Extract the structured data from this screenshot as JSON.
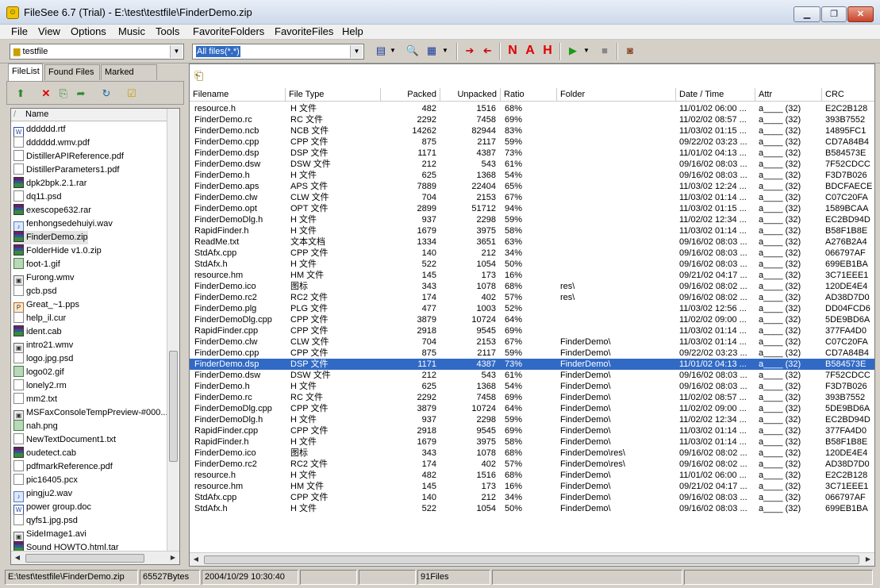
{
  "window": {
    "title": "FileSee 6.7 (Trial) - E:\\test\\testfile\\FinderDemo.zip",
    "min": "▁",
    "max": "❐",
    "close": "✕"
  },
  "menu": [
    "File",
    "View",
    "Options",
    "Music",
    "Tools",
    "FavoriteFolders",
    "FavoriteFiles",
    "Help"
  ],
  "toolbar": {
    "folder_combo": "testfile",
    "filter_combo": "All files(*.*)",
    "letters": [
      "N",
      "A",
      "H"
    ]
  },
  "left": {
    "tabs": [
      "FileList",
      "Found Files",
      "Marked Files"
    ],
    "column_header": "Name",
    "items": [
      {
        "name": "dddddd.rtf",
        "icon": "doc"
      },
      {
        "name": "dddddd.wmv.pdf",
        "icon": "file"
      },
      {
        "name": "DistillerAPIReference.pdf",
        "icon": "file"
      },
      {
        "name": "DistillerParameters1.pdf",
        "icon": "file"
      },
      {
        "name": "dpk2bpk.2.1.rar",
        "icon": "rar"
      },
      {
        "name": "dq11.psd",
        "icon": "file"
      },
      {
        "name": "exescope632.rar",
        "icon": "rar"
      },
      {
        "name": "fenhongsedehuiyi.wav",
        "icon": "aud"
      },
      {
        "name": "FinderDemo.zip",
        "icon": "rar"
      },
      {
        "name": "FolderHide v1.0.zip",
        "icon": "rar"
      },
      {
        "name": "foot-1.gif",
        "icon": "img"
      },
      {
        "name": "Furong.wmv",
        "icon": "vid"
      },
      {
        "name": "gcb.psd",
        "icon": "file"
      },
      {
        "name": "Great_~1.pps",
        "icon": "pps"
      },
      {
        "name": "help_il.cur",
        "icon": "file"
      },
      {
        "name": "ident.cab",
        "icon": "rar"
      },
      {
        "name": "intro21.wmv",
        "icon": "vid"
      },
      {
        "name": "logo.jpg.psd",
        "icon": "file"
      },
      {
        "name": "logo02.gif",
        "icon": "img"
      },
      {
        "name": "lonely2.rm",
        "icon": "file"
      },
      {
        "name": "mm2.txt",
        "icon": "file"
      },
      {
        "name": "MSFaxConsoleTempPreview-#000...",
        "icon": "vid"
      },
      {
        "name": "nah.png",
        "icon": "img"
      },
      {
        "name": "NewTextDocument1.txt",
        "icon": "file"
      },
      {
        "name": "oudetect.cab",
        "icon": "rar"
      },
      {
        "name": "pdfmarkReference.pdf",
        "icon": "file"
      },
      {
        "name": "pic16405.pcx",
        "icon": "file"
      },
      {
        "name": "pingju2.wav",
        "icon": "aud"
      },
      {
        "name": "power group.doc",
        "icon": "doc"
      },
      {
        "name": "qyfs1.jpg.psd",
        "icon": "file"
      },
      {
        "name": "SideImage1.avi",
        "icon": "vid"
      },
      {
        "name": "Sound HOWTO.html.tar",
        "icon": "rar"
      }
    ]
  },
  "list": {
    "columns": [
      "Filename",
      "File Type",
      "Packed",
      "Unpacked",
      "Ratio",
      "Folder",
      "Date / Time",
      "Attr",
      "CRC"
    ],
    "rows": [
      [
        "resource.h",
        "H 文件",
        "482",
        "1516",
        "68%",
        "",
        "11/01/02 06:00 ...",
        "a____ (32)",
        "E2C2B128"
      ],
      [
        "FinderDemo.rc",
        "RC 文件",
        "2292",
        "7458",
        "69%",
        "",
        "11/02/02 08:57 ...",
        "a____ (32)",
        "393B7552"
      ],
      [
        "FinderDemo.ncb",
        "NCB 文件",
        "14262",
        "82944",
        "83%",
        "",
        "11/03/02 01:15 ...",
        "a____ (32)",
        "14895FC1"
      ],
      [
        "FinderDemo.cpp",
        "CPP 文件",
        "875",
        "2117",
        "59%",
        "",
        "09/22/02 03:23 ...",
        "a____ (32)",
        "CD7A84B4"
      ],
      [
        "FinderDemo.dsp",
        "DSP 文件",
        "1171",
        "4387",
        "73%",
        "",
        "11/01/02 04:13 ...",
        "a____ (32)",
        "B584573E"
      ],
      [
        "FinderDemo.dsw",
        "DSW 文件",
        "212",
        "543",
        "61%",
        "",
        "09/16/02 08:03 ...",
        "a____ (32)",
        "7F52CDCC"
      ],
      [
        "FinderDemo.h",
        "H 文件",
        "625",
        "1368",
        "54%",
        "",
        "09/16/02 08:03 ...",
        "a____ (32)",
        "F3D7B026"
      ],
      [
        "FinderDemo.aps",
        "APS 文件",
        "7889",
        "22404",
        "65%",
        "",
        "11/03/02 12:24 ...",
        "a____ (32)",
        "BDCFAECE"
      ],
      [
        "FinderDemo.clw",
        "CLW 文件",
        "704",
        "2153",
        "67%",
        "",
        "11/03/02 01:14 ...",
        "a____ (32)",
        "C07C20FA"
      ],
      [
        "FinderDemo.opt",
        "OPT 文件",
        "2899",
        "51712",
        "94%",
        "",
        "11/03/02 01:15 ...",
        "a____ (32)",
        "1589BCAA"
      ],
      [
        "FinderDemoDlg.h",
        "H 文件",
        "937",
        "2298",
        "59%",
        "",
        "11/02/02 12:34 ...",
        "a____ (32)",
        "EC2BD94D"
      ],
      [
        "RapidFinder.h",
        "H 文件",
        "1679",
        "3975",
        "58%",
        "",
        "11/03/02 01:14 ...",
        "a____ (32)",
        "B58F1B8E"
      ],
      [
        "ReadMe.txt",
        "文本文档",
        "1334",
        "3651",
        "63%",
        "",
        "09/16/02 08:03 ...",
        "a____ (32)",
        "A276B2A4"
      ],
      [
        "StdAfx.cpp",
        "CPP 文件",
        "140",
        "212",
        "34%",
        "",
        "09/16/02 08:03 ...",
        "a____ (32)",
        "066797AF"
      ],
      [
        "StdAfx.h",
        "H 文件",
        "522",
        "1054",
        "50%",
        "",
        "09/16/02 08:03 ...",
        "a____ (32)",
        "699EB1BA"
      ],
      [
        "resource.hm",
        "HM 文件",
        "145",
        "173",
        "16%",
        "",
        "09/21/02 04:17 ...",
        "a____ (32)",
        "3C71EEE1"
      ],
      [
        "FinderDemo.ico",
        "图标",
        "343",
        "1078",
        "68%",
        "res\\",
        "09/16/02 08:02 ...",
        "a____ (32)",
        "120DE4E4"
      ],
      [
        "FinderDemo.rc2",
        "RC2 文件",
        "174",
        "402",
        "57%",
        "res\\",
        "09/16/02 08:02 ...",
        "a____ (32)",
        "AD38D7D0"
      ],
      [
        "FinderDemo.plg",
        "PLG 文件",
        "477",
        "1003",
        "52%",
        "",
        "11/03/02 12:56 ...",
        "a____ (32)",
        "DD04FCD6"
      ],
      [
        "FinderDemoDlg.cpp",
        "CPP 文件",
        "3879",
        "10724",
        "64%",
        "",
        "11/02/02 09:00 ...",
        "a____ (32)",
        "5DE9BD6A"
      ],
      [
        "RapidFinder.cpp",
        "CPP 文件",
        "2918",
        "9545",
        "69%",
        "",
        "11/03/02 01:14 ...",
        "a____ (32)",
        "377FA4D0"
      ],
      [
        "FinderDemo.clw",
        "CLW 文件",
        "704",
        "2153",
        "67%",
        "FinderDemo\\",
        "11/03/02 01:14 ...",
        "a____ (32)",
        "C07C20FA"
      ],
      [
        "FinderDemo.cpp",
        "CPP 文件",
        "875",
        "2117",
        "59%",
        "FinderDemo\\",
        "09/22/02 03:23 ...",
        "a____ (32)",
        "CD7A84B4"
      ],
      [
        "FinderDemo.dsp",
        "DSP 文件",
        "1171",
        "4387",
        "73%",
        "FinderDemo\\",
        "11/01/02 04:13 ...",
        "a____ (32)",
        "B584573E"
      ],
      [
        "FinderDemo.dsw",
        "DSW 文件",
        "212",
        "543",
        "61%",
        "FinderDemo\\",
        "09/16/02 08:03 ...",
        "a____ (32)",
        "7F52CDCC"
      ],
      [
        "FinderDemo.h",
        "H 文件",
        "625",
        "1368",
        "54%",
        "FinderDemo\\",
        "09/16/02 08:03 ...",
        "a____ (32)",
        "F3D7B026"
      ],
      [
        "FinderDemo.rc",
        "RC 文件",
        "2292",
        "7458",
        "69%",
        "FinderDemo\\",
        "11/02/02 08:57 ...",
        "a____ (32)",
        "393B7552"
      ],
      [
        "FinderDemoDlg.cpp",
        "CPP 文件",
        "3879",
        "10724",
        "64%",
        "FinderDemo\\",
        "11/02/02 09:00 ...",
        "a____ (32)",
        "5DE9BD6A"
      ],
      [
        "FinderDemoDlg.h",
        "H 文件",
        "937",
        "2298",
        "59%",
        "FinderDemo\\",
        "11/02/02 12:34 ...",
        "a____ (32)",
        "EC2BD94D"
      ],
      [
        "RapidFinder.cpp",
        "CPP 文件",
        "2918",
        "9545",
        "69%",
        "FinderDemo\\",
        "11/03/02 01:14 ...",
        "a____ (32)",
        "377FA4D0"
      ],
      [
        "RapidFinder.h",
        "H 文件",
        "1679",
        "3975",
        "58%",
        "FinderDemo\\",
        "11/03/02 01:14 ...",
        "a____ (32)",
        "B58F1B8E"
      ],
      [
        "FinderDemo.ico",
        "图标",
        "343",
        "1078",
        "68%",
        "FinderDemo\\res\\",
        "09/16/02 08:02 ...",
        "a____ (32)",
        "120DE4E4"
      ],
      [
        "FinderDemo.rc2",
        "RC2 文件",
        "174",
        "402",
        "57%",
        "FinderDemo\\res\\",
        "09/16/02 08:02 ...",
        "a____ (32)",
        "AD38D7D0"
      ],
      [
        "resource.h",
        "H 文件",
        "482",
        "1516",
        "68%",
        "FinderDemo\\",
        "11/01/02 06:00 ...",
        "a____ (32)",
        "E2C2B128"
      ],
      [
        "resource.hm",
        "HM 文件",
        "145",
        "173",
        "16%",
        "FinderDemo\\",
        "09/21/02 04:17 ...",
        "a____ (32)",
        "3C71EEE1"
      ],
      [
        "StdAfx.cpp",
        "CPP 文件",
        "140",
        "212",
        "34%",
        "FinderDemo\\",
        "09/16/02 08:03 ...",
        "a____ (32)",
        "066797AF"
      ],
      [
        "StdAfx.h",
        "H 文件",
        "522",
        "1054",
        "50%",
        "FinderDemo\\",
        "09/16/02 08:03 ...",
        "a____ (32)",
        "699EB1BA"
      ]
    ],
    "selected_index": 23
  },
  "status": {
    "path": "E:\\test\\testfile\\FinderDemo.zip",
    "size": "65527Bytes",
    "datetime": "2004/10/29 10:30:40",
    "count": "91Files"
  },
  "colors": {
    "selection": "#316ac5",
    "letters": "#e00000",
    "close_button": "#c8432a"
  }
}
